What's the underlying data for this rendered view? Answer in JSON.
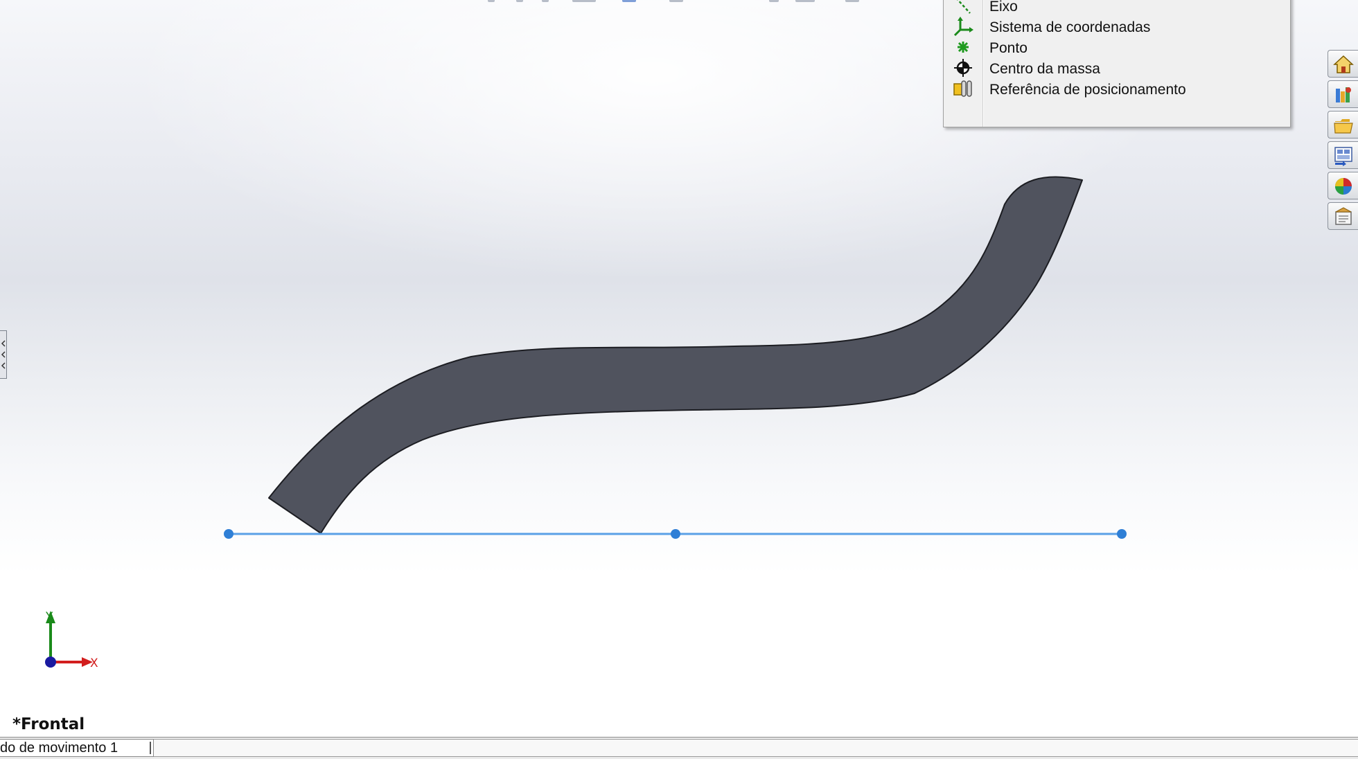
{
  "context_menu": {
    "items": [
      {
        "label": "Eixo",
        "icon": "axis-icon"
      },
      {
        "label": "Sistema de coordenadas",
        "icon": "coordinate-system-icon"
      },
      {
        "label": "Ponto",
        "icon": "point-icon"
      },
      {
        "label": "Centro da massa",
        "icon": "center-of-mass-icon"
      },
      {
        "label": "Referência de posicionamento",
        "icon": "mate-reference-icon"
      }
    ]
  },
  "task_pane": {
    "tabs": [
      {
        "icon": "home-icon"
      },
      {
        "icon": "design-library-icon"
      },
      {
        "icon": "file-explorer-icon"
      },
      {
        "icon": "view-palette-icon"
      },
      {
        "icon": "appearances-icon"
      },
      {
        "icon": "custom-properties-icon"
      }
    ]
  },
  "triad": {
    "x_label": "X",
    "y_label": "Y"
  },
  "view": {
    "name": "*Frontal"
  },
  "bottom_tabs": [
    {
      "label": "do de movimento 1"
    }
  ],
  "colors": {
    "part_fill": "#50535e",
    "sketch_line": "#5aa0e6",
    "sketch_point": "#2f7fd6",
    "triad_x": "#d21e1e",
    "triad_y": "#1a8a1a",
    "triad_z": "#1a1aa0"
  }
}
